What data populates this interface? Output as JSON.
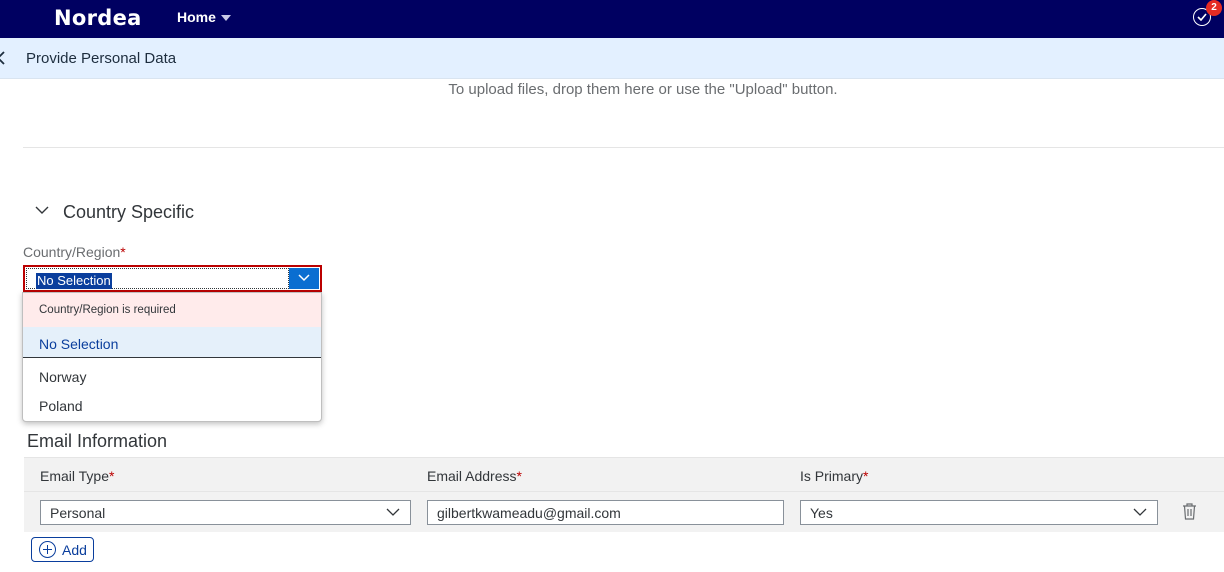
{
  "shell": {
    "logo": "Nordea",
    "home_label": "Home",
    "notification_count": "2"
  },
  "header": {
    "title": "Provide Personal Data"
  },
  "upload": {
    "hint": "To upload files, drop them here or use the \"Upload\" button."
  },
  "country_section": {
    "title": "Country Specific",
    "field_label": "Country/Region",
    "required_mark": "*",
    "selected_value": "No Selection",
    "error_message": "Country/Region is required",
    "options": [
      "No Selection",
      "Norway",
      "Poland"
    ]
  },
  "email_section": {
    "title": "Email Information",
    "columns": [
      "Email Type",
      "Email Address",
      "Is Primary"
    ],
    "required_mark": "*",
    "rows": [
      {
        "email_type": "Personal",
        "email_address": "gilbertkwameadu@gmail.com",
        "is_primary": "Yes"
      }
    ],
    "add_label": "Add"
  },
  "colors": {
    "shell_bg": "#000061",
    "subheader_bg": "#e3f0ff",
    "error_border": "#bb0000",
    "accent": "#0a6ed1"
  }
}
